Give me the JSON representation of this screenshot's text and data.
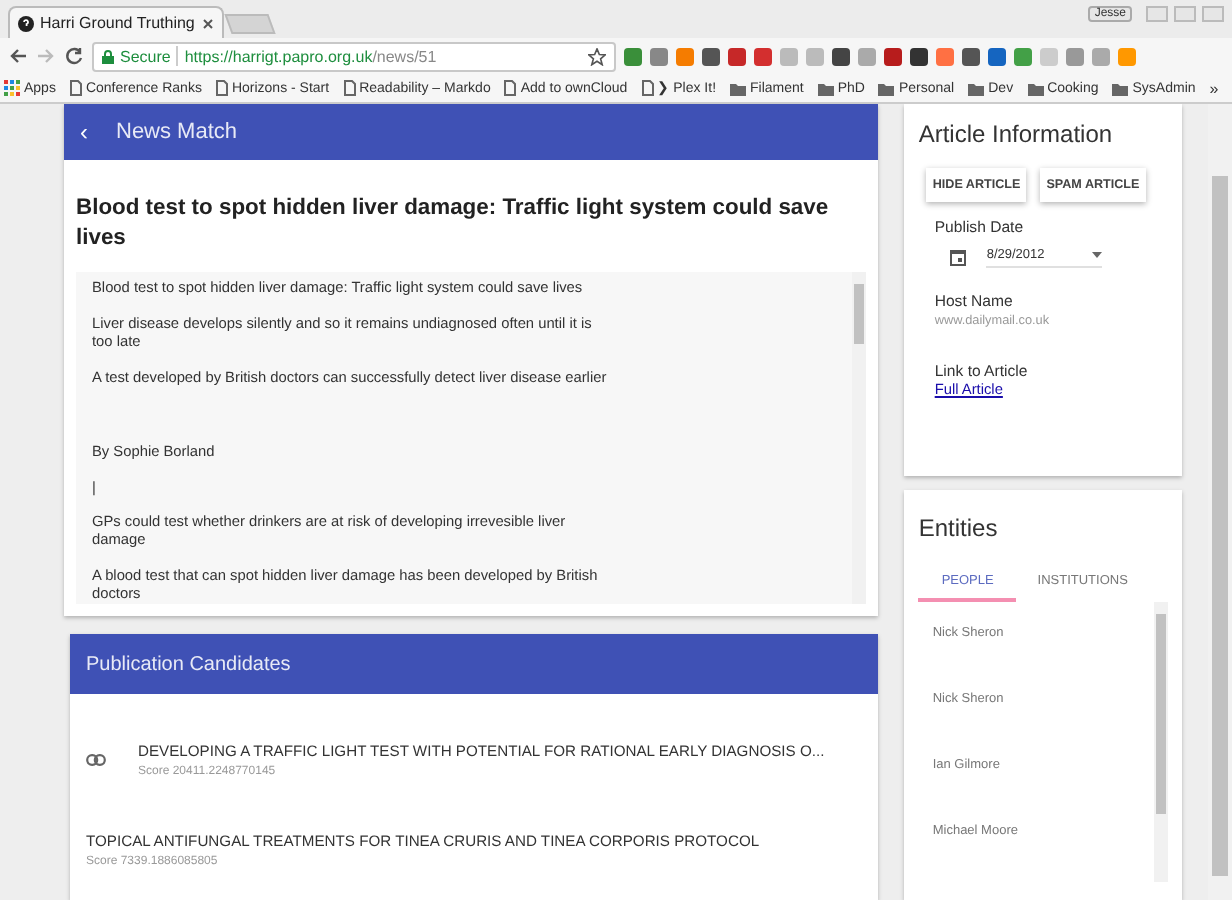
{
  "browser": {
    "tab_title": "Harri Ground Truthing",
    "user_badge": "Jesse",
    "secure_label": "Secure",
    "url_host": "https://harrigt.papro.org.uk",
    "url_path": "/news/51",
    "bookmarks": [
      {
        "label": "Apps",
        "kind": "apps"
      },
      {
        "label": "Conference Ranks",
        "kind": "page"
      },
      {
        "label": "Horizons - Start",
        "kind": "page"
      },
      {
        "label": "Readability – Markdo",
        "kind": "page"
      },
      {
        "label": "Add to ownCloud",
        "kind": "page"
      },
      {
        "label": "❯ Plex It!",
        "kind": "page"
      },
      {
        "label": "Filament",
        "kind": "folder"
      },
      {
        "label": "PhD",
        "kind": "folder"
      },
      {
        "label": "Personal",
        "kind": "folder"
      },
      {
        "label": "Dev",
        "kind": "folder"
      },
      {
        "label": "Cooking",
        "kind": "folder"
      },
      {
        "label": "SysAdmin",
        "kind": "folder"
      }
    ],
    "more": "»"
  },
  "article": {
    "header": "News Match",
    "back": "‹",
    "title": "Blood test to spot hidden liver damage: Traffic light system could save lives",
    "sections": [
      [
        "Blood test to spot hidden liver damage: Traffic light system could save lives",
        "Liver disease develops silently and so it remains undiagnosed often until it is too late",
        "A test developed by British doctors can successfully detect liver disease earlier"
      ],
      [
        "By Sophie Borland",
        "|",
        "GPs could test whether drinkers are at risk of developing irrevesible liver damage",
        "A blood test that can spot hidden liver damage has been developed by British doctors"
      ]
    ]
  },
  "candidates": {
    "header": "Publication Candidates",
    "items": [
      {
        "title": "DEVELOPING A TRAFFIC LIGHT TEST WITH POTENTIAL FOR RATIONAL EARLY DIAGNOSIS O...",
        "score": "Score 20411.2248770145",
        "linked": true
      },
      {
        "title": "TOPICAL ANTIFUNGAL TREATMENTS FOR TINEA CRURIS AND TINEA CORPORIS PROTOCOL",
        "score": "Score 7339.1886085805",
        "linked": false
      }
    ]
  },
  "article_info": {
    "title": "Article Information",
    "buttons": [
      "HIDE ARTICLE",
      "SPAM ARTICLE"
    ],
    "publish_label": "Publish Date",
    "publish_date": "8/29/2012",
    "host_label": "Host Name",
    "host": "www.dailymail.co.uk",
    "link_label": "Link to Article",
    "link": "Full Article"
  },
  "entities": {
    "title": "Entities",
    "tabs": [
      {
        "label": "PEOPLE",
        "selected": true
      },
      {
        "label": "INSTITUTIONS",
        "selected": false
      }
    ],
    "items": [
      "Nick Sheron",
      "Nick Sheron",
      "Ian Gilmore",
      "Michael Moore"
    ]
  }
}
